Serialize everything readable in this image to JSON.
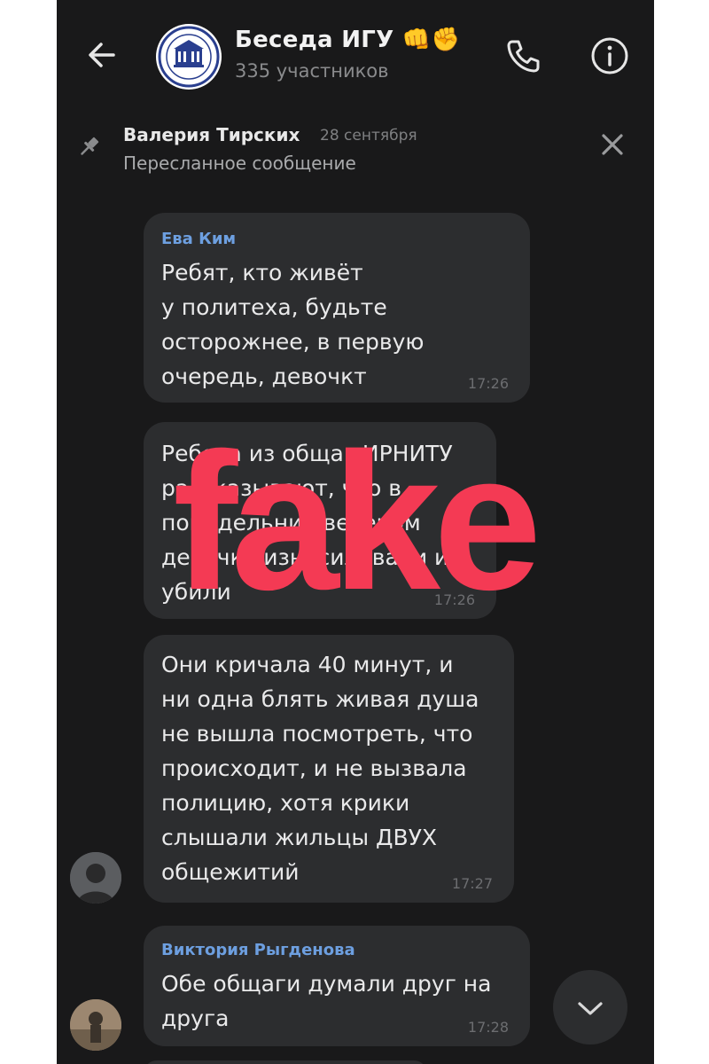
{
  "header": {
    "title": "Беседа ИГУ 👊✊",
    "subtitle": "335 участников"
  },
  "pinned": {
    "author": "Валерия Тирских",
    "date": "28 сентября",
    "text": "Пересланное сообщение"
  },
  "messages": [
    {
      "sender": "Ева Ким",
      "text": "Ребят, кто живёт\nу политеха, будьте\nосторожнее, в первую\nочередь, девочкт",
      "time": "17:26"
    },
    {
      "sender": "",
      "text": "Ребята из общаг ИРНИТУ\nрассказывают, что в\nпонедельник вечером\nдевочку изнасиловали и\nубили",
      "time": "17:26"
    },
    {
      "sender": "",
      "text": "Они кричала 40 минут, и\nни одна блять живая душа\nне вышла посмотреть, что\nпроисходит, и не вызвала\nполицию, хотя крики\nслышали жильцы ДВУХ\nобщежитий",
      "time": "17:27"
    },
    {
      "sender": "Виктория Рыгденова",
      "text": "Обе общаги думали друг на\nдруга",
      "time": "17:28"
    }
  ],
  "overlay": {
    "stamp": "fake"
  },
  "colors": {
    "background": "#19191a",
    "bubble": "#2c2d2f",
    "sender_name": "#6d9fe0",
    "stamp": "#f43a54"
  },
  "icons": [
    "back-arrow-icon",
    "phone-icon",
    "info-icon",
    "pin-icon",
    "close-icon",
    "chevron-down-icon"
  ]
}
